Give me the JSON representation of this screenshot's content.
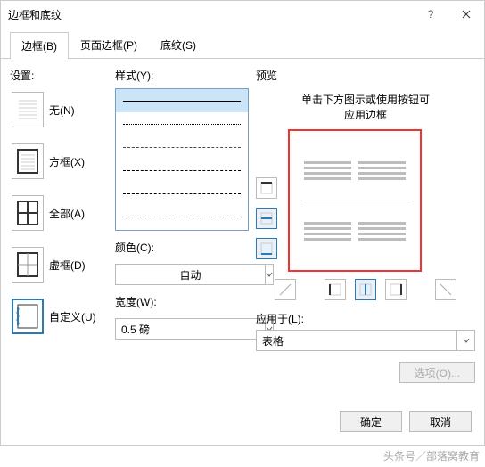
{
  "dialog": {
    "title": "边框和底纹"
  },
  "tabs": {
    "border": "边框(B)",
    "page_border": "页面边框(P)",
    "shading": "底纹(S)"
  },
  "settings": {
    "label": "设置:",
    "none": "无(N)",
    "box": "方框(X)",
    "all": "全部(A)",
    "grid": "虚框(D)",
    "custom": "自定义(U)"
  },
  "style": {
    "label": "样式(Y):",
    "color_label": "颜色(C):",
    "color_value": "自动",
    "width_label": "宽度(W):",
    "width_value": "0.5 磅"
  },
  "preview": {
    "label": "预览",
    "hint_line1": "单击下方图示或使用按钮可",
    "hint_line2": "应用边框",
    "apply_label": "应用于(L):",
    "apply_value": "表格",
    "options_btn": "选项(O)..."
  },
  "footer": {
    "ok": "确定",
    "cancel": "取消"
  },
  "watermark": "头条号／部落窝教育"
}
